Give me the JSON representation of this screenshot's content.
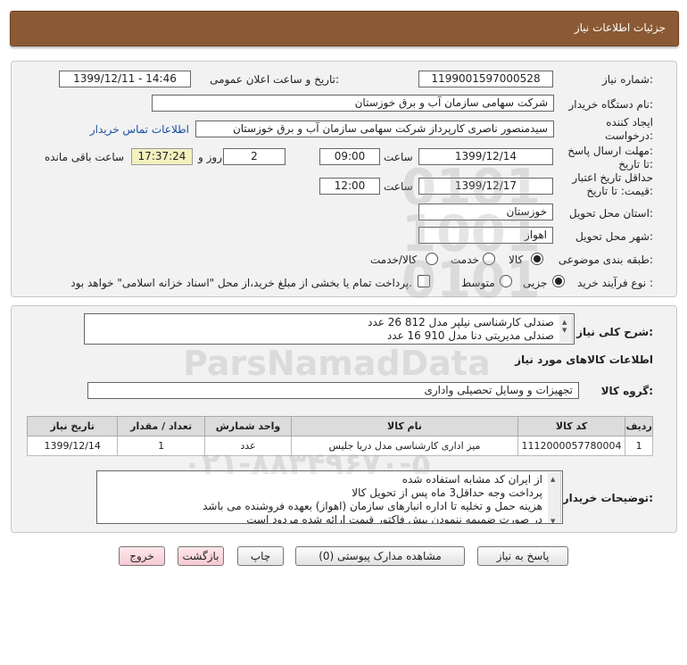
{
  "header": {
    "title": "جزئیات اطلاعات نیاز"
  },
  "form": {
    "need_number_label": "شماره نیاز:",
    "need_number": "1199001597000528",
    "announce_label": "تاریخ و ساعت اعلان عمومی:",
    "announce_value": "1399/12/11 - 14:46",
    "buyer_org_label": "نام دستگاه خریدار:",
    "buyer_org": "شرکت سهامی سازمان آب و برق خوزستان",
    "requester_label_1": "ایجاد کننده",
    "requester_label_2": "درخواست:",
    "requester": "سیدمنصور ناصری کارپرداز شرکت سهامی سازمان آب و برق خوزستان",
    "contact_link": "اطلاعات تماس خریدار",
    "reply_label_1": "مهلت ارسال پاسخ:",
    "reply_label_2": "تا تاریخ:",
    "reply_date": "1399/12/14",
    "time_label": "ساعت",
    "reply_time": "09:00",
    "days_value": "2",
    "days_label": "روز و",
    "timer_value": "17:37:24",
    "remaining_label": "ساعت باقی مانده",
    "validity_label_1": "حداقل تاریخ اعتبار",
    "validity_label_2": "قیمت: تا تاریخ:",
    "validity_date": "1399/12/17",
    "validity_time": "12:00",
    "province_label": "استان محل تحویل:",
    "province": "خوزستان",
    "city_label": "شهر محل تحویل:",
    "city": "اهواز",
    "category_label": "طبقه بندی موضوعی:",
    "category_options": [
      "کالا",
      "خدمت",
      "کالا/خدمت"
    ],
    "category_selected": "کالا",
    "process_label": "نوع فرآیند خرید :",
    "process_options": [
      "جزیی",
      "متوسط"
    ],
    "process_selected": "جزیی",
    "treasury_text": "پرداخت تمام یا بخشی از مبلغ خرید،از محل \"اسناد خزانه اسلامی\" خواهد بود."
  },
  "summary": {
    "label": "شرح کلی نیاز:",
    "lines": [
      "صندلی کارشناسی نیلپر مدل 812 26 عدد",
      "صندلی مدیریتی دنا مدل 910 16 عدد"
    ]
  },
  "goods_info": {
    "title": "اطلاعات کالاهای مورد نیاز",
    "group_label": "گروه کالا:",
    "group_value": "تجهیزات و وسایل تحصیلی واداری"
  },
  "table": {
    "headers": [
      "ردیف",
      "کد کالا",
      "نام کالا",
      "واحد شمارش",
      "تعداد / مقدار",
      "تاریخ نیاز"
    ],
    "rows": [
      [
        "1",
        "1112000057780004",
        "میز اداری کارشناسی مدل دریا جلیس",
        "عدد",
        "1",
        "1399/12/14"
      ]
    ]
  },
  "buyer_notes": {
    "label": "توضیحات خریدار:",
    "lines": [
      "از ایران کد مشابه استفاده شده",
      "پرداخت وجه حداقل3 ماه پس از تحویل کالا",
      "هزینه حمل و تخلیه تا اداره انبارهای سازمان (اهواز) بعهده فروشنده می باشد",
      "در صورت ضمیمه ننمودن پیش فاکتور  قیمت ارائه شده مردود است"
    ]
  },
  "buttons": {
    "reply": "پاسخ به نیاز",
    "attachments": "مشاهده مدارک پیوستی (0)",
    "print": "چاپ",
    "back": "بازگشت",
    "exit": "خروج"
  },
  "colors": {
    "header_bg": "#8b5a34",
    "link": "#1a4fa0",
    "timer_bg": "#f4f0c0"
  }
}
